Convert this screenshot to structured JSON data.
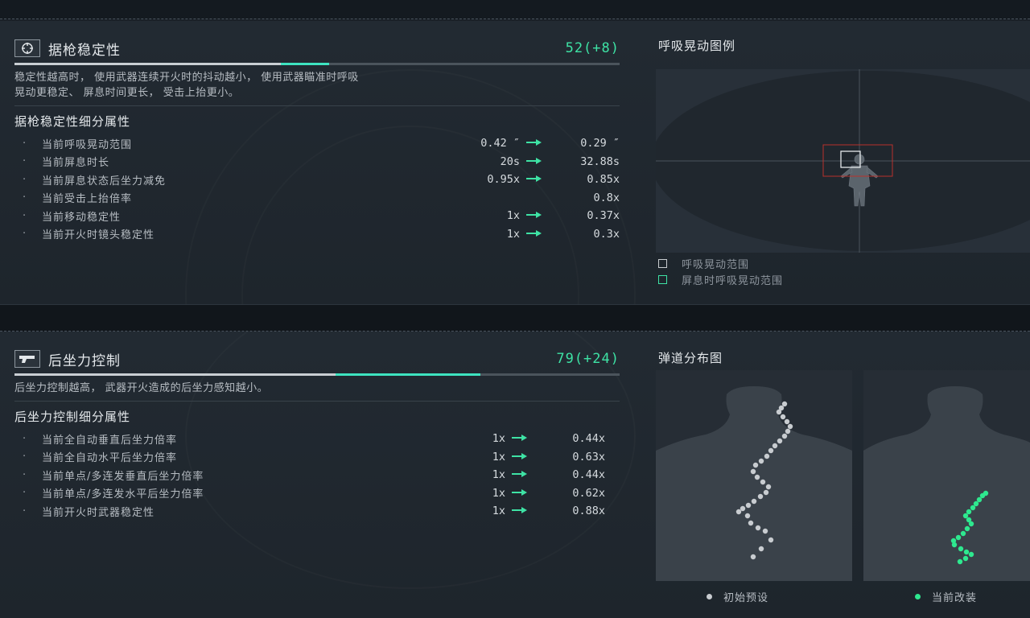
{
  "colors": {
    "accent": "#3ee3a5",
    "accent_bar": "#3ee3c0",
    "sway_red": "#b8322c",
    "initial_dot": "#c8ccd0",
    "current_dot": "#2ee88f"
  },
  "stability": {
    "icon": "crosshair-icon",
    "title": "据枪稳定性",
    "score": "52(+8)",
    "base_fraction": 0.44,
    "bonus_fraction": 0.08,
    "description_line1": "稳定性越高时， 使用武器连续开火时的抖动越小， 使用武器瞄准时呼吸",
    "description_line2": "晃动更稳定、 屏息时间更长， 受击上抬更小。",
    "subtitle": "据枪稳定性细分属性",
    "rows": [
      {
        "label": "当前呼吸晃动范围",
        "from": "0.42 ″",
        "to": "0.29 ″",
        "arrow": true
      },
      {
        "label": "当前屏息时长",
        "from": "20s",
        "to": "32.88s",
        "arrow": true
      },
      {
        "label": "当前屏息状态后坐力减免",
        "from": "0.95x",
        "to": "0.85x",
        "arrow": true
      },
      {
        "label": "当前受击上抬倍率",
        "from": "",
        "to": "0.8x",
        "arrow": false
      },
      {
        "label": "当前移动稳定性",
        "from": "1x",
        "to": "0.37x",
        "arrow": true
      },
      {
        "label": "当前开火时镜头稳定性",
        "from": "1x",
        "to": "0.3x",
        "arrow": true
      }
    ]
  },
  "sway_chart": {
    "title": "呼吸晃动图例",
    "legend": [
      {
        "label": "呼吸晃动范围",
        "color": "#c8ccd0"
      },
      {
        "label": "屏息时呼吸晃动范围",
        "color": "#3ee3a5"
      }
    ]
  },
  "recoil": {
    "icon": "pistol-icon",
    "title": "后坐力控制",
    "score": "79(+24)",
    "base_fraction": 0.53,
    "bonus_fraction": 0.24,
    "description": "后坐力控制越高， 武器开火造成的后坐力感知越小。",
    "subtitle": "后坐力控制细分属性",
    "rows": [
      {
        "label": "当前全自动垂直后坐力倍率",
        "from": "1x",
        "to": "0.44x",
        "arrow": true
      },
      {
        "label": "当前全自动水平后坐力倍率",
        "from": "1x",
        "to": "0.63x",
        "arrow": true
      },
      {
        "label": "当前单点/多连发垂直后坐力倍率",
        "from": "1x",
        "to": "0.44x",
        "arrow": true
      },
      {
        "label": "当前单点/多连发水平后坐力倍率",
        "from": "1x",
        "to": "0.62x",
        "arrow": true
      },
      {
        "label": "当前开火时武器稳定性",
        "from": "1x",
        "to": "0.88x",
        "arrow": true
      }
    ]
  },
  "spread_chart": {
    "title": "弹道分布图",
    "legend": [
      {
        "label": "初始预设",
        "color": "#c8ccd0"
      },
      {
        "label": "当前改装",
        "color": "#2ee88f"
      }
    ]
  }
}
